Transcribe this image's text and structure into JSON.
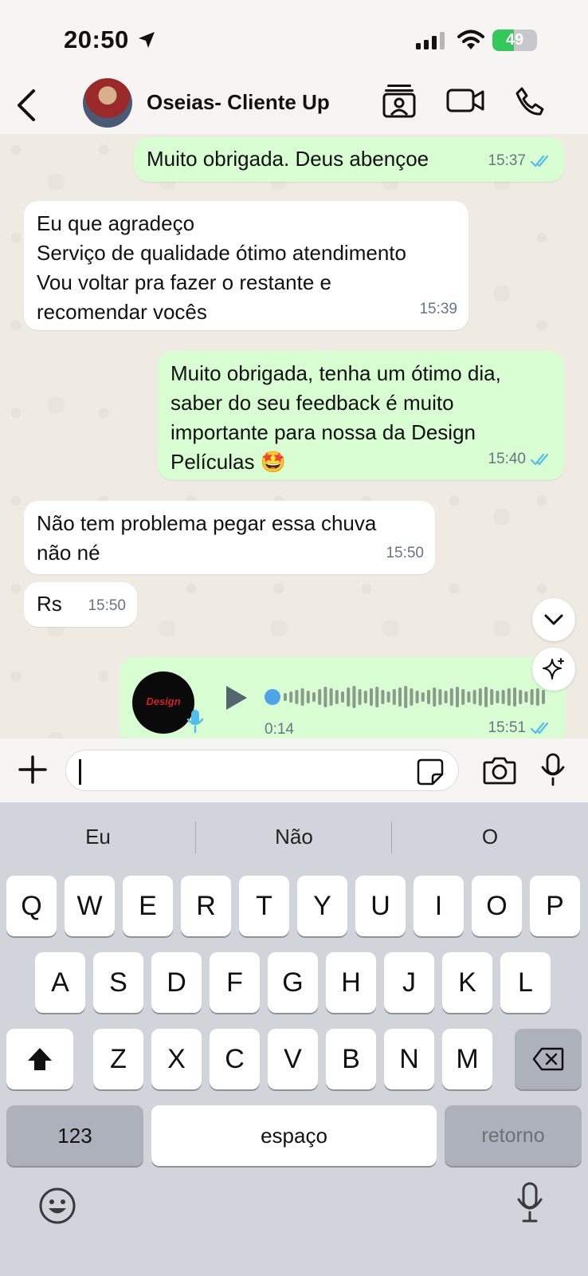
{
  "status_bar": {
    "time": "20:50",
    "battery": "49",
    "battery_fraction": 0.49,
    "icons": [
      "location-arrow-icon",
      "signal-icon",
      "wifi-icon",
      "battery-charging-icon"
    ]
  },
  "header": {
    "contact_name": "Oseias- Cliente Up",
    "icons": [
      "back-icon",
      "contacts-icon",
      "video-call-icon",
      "phone-icon"
    ]
  },
  "messages": [
    {
      "side": "out",
      "text": "Muito obrigada. Deus abençoe",
      "time": "15:37",
      "read": true
    },
    {
      "side": "in",
      "text": "Eu que agradeço\nServiço de qualidade ótimo atendimento\nVou voltar pra fazer o restante e\nrecomendar vocês",
      "time": "15:39"
    },
    {
      "side": "out",
      "text": "Muito obrigada, tenha um ótimo dia,\nsaber do seu feedback é muito\nimportante para nossa da Design\nPelículas 🤩",
      "time": "15:40",
      "read": true
    },
    {
      "side": "in",
      "text": "Não tem problema pegar essa chuva\nnão né",
      "time": "15:50"
    },
    {
      "side": "in",
      "text": "Rs",
      "time": "15:50"
    }
  ],
  "voice_message": {
    "side": "out",
    "duration": "0:14",
    "time": "15:51",
    "read": true,
    "progress": 0
  },
  "input": {
    "value": "",
    "icons": [
      "plus-icon",
      "sticker-icon",
      "camera-icon",
      "microphone-icon"
    ]
  },
  "keyboard": {
    "suggestions": [
      "Eu",
      "Não",
      "O"
    ],
    "row1": [
      "Q",
      "W",
      "E",
      "R",
      "T",
      "Y",
      "U",
      "I",
      "O",
      "P"
    ],
    "row2": [
      "A",
      "S",
      "D",
      "F",
      "G",
      "H",
      "J",
      "K",
      "L"
    ],
    "row3": [
      "Z",
      "X",
      "C",
      "V",
      "B",
      "N",
      "M"
    ],
    "numbers_label": "123",
    "space_label": "espaço",
    "return_label": "retorno"
  },
  "colors": {
    "outgoing_bubble": "#d9fdd3",
    "incoming_bubble": "#ffffff",
    "read_ticks": "#53bdeb",
    "battery_green": "#34c759"
  }
}
